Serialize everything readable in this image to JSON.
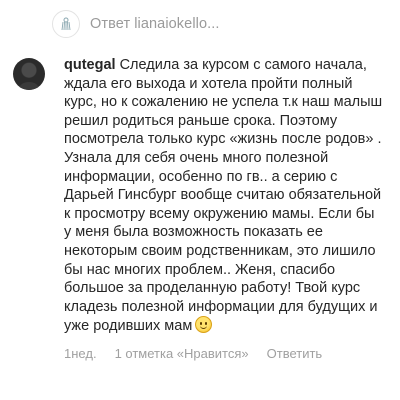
{
  "reply_header": {
    "label": "Ответ",
    "username": "lianaiokello..."
  },
  "comment": {
    "username": "qutegal",
    "text": "Следила за курсом с самого начала, ждала его выхода и хотела пройти полный курс, но к сожалению не успела т.к наш малыш решил родиться раньше срока. Поэтому посмотрела только курс «жизнь после родов» . Узнала для себя очень много полезной информации, особенно по гв.. а серию с Дарьей Гинсбург вообще считаю обязательной к просмотру всему окружению мамы. Если бы у меня была возможность показать ее некоторым своим родственникам, это лишило бы нас многих проблем.. Женя, спасибо большое за проделанную работу! Твой курс кладезь полезной информации для будущих и уже родивших мам",
    "meta": {
      "time": "1нед.",
      "likes": "1 отметка «Нравится»",
      "reply": "Ответить"
    }
  },
  "icons": {
    "reply_avatar": "tassel-logo-icon",
    "emoji": "smiling-face-emoji"
  },
  "colors": {
    "text": "#262626",
    "secondary": "#9a9a9a"
  }
}
